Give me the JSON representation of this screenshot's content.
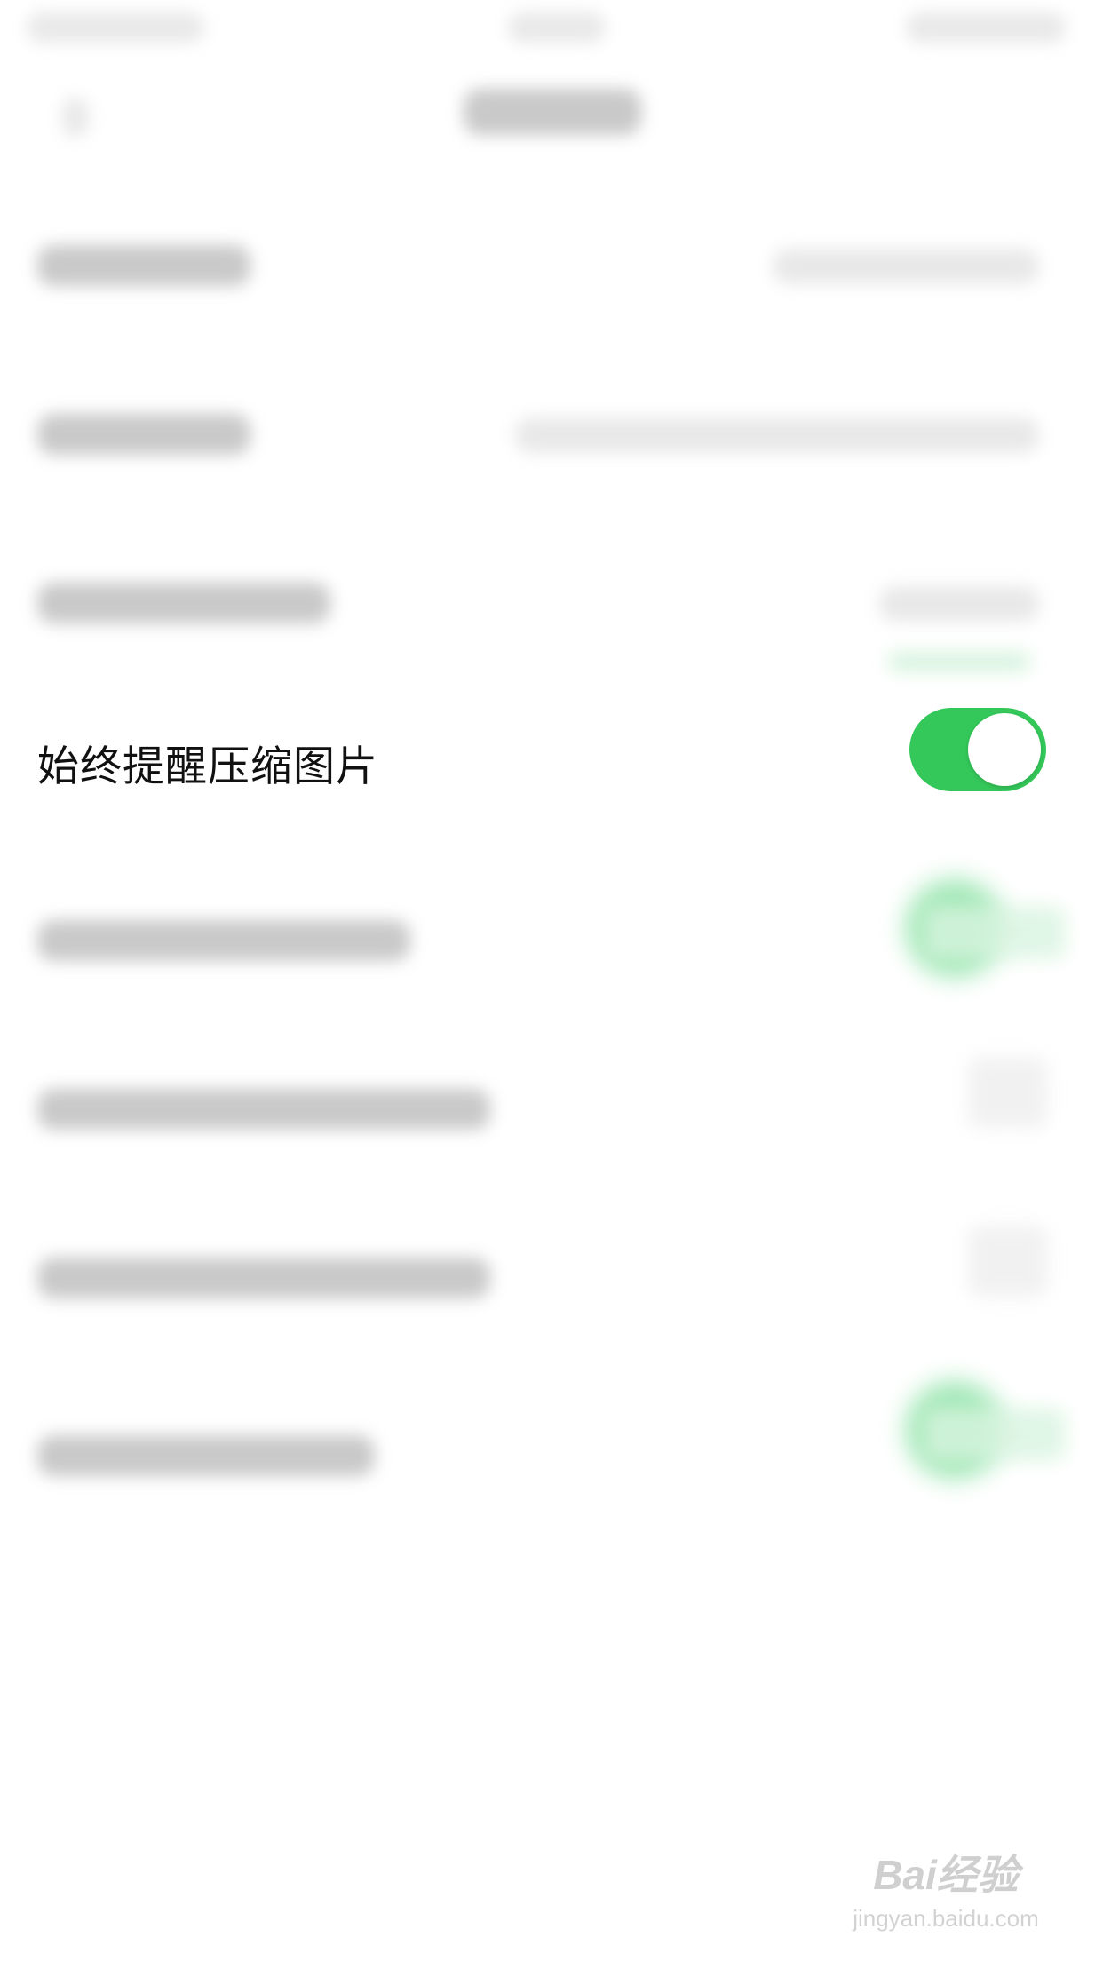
{
  "setting": {
    "label": "始终提醒压缩图片",
    "enabled": true
  },
  "toggle_on_color": "#34c759",
  "watermark": {
    "brand": "Bai经验",
    "url": "jingyan.baidu.com"
  }
}
